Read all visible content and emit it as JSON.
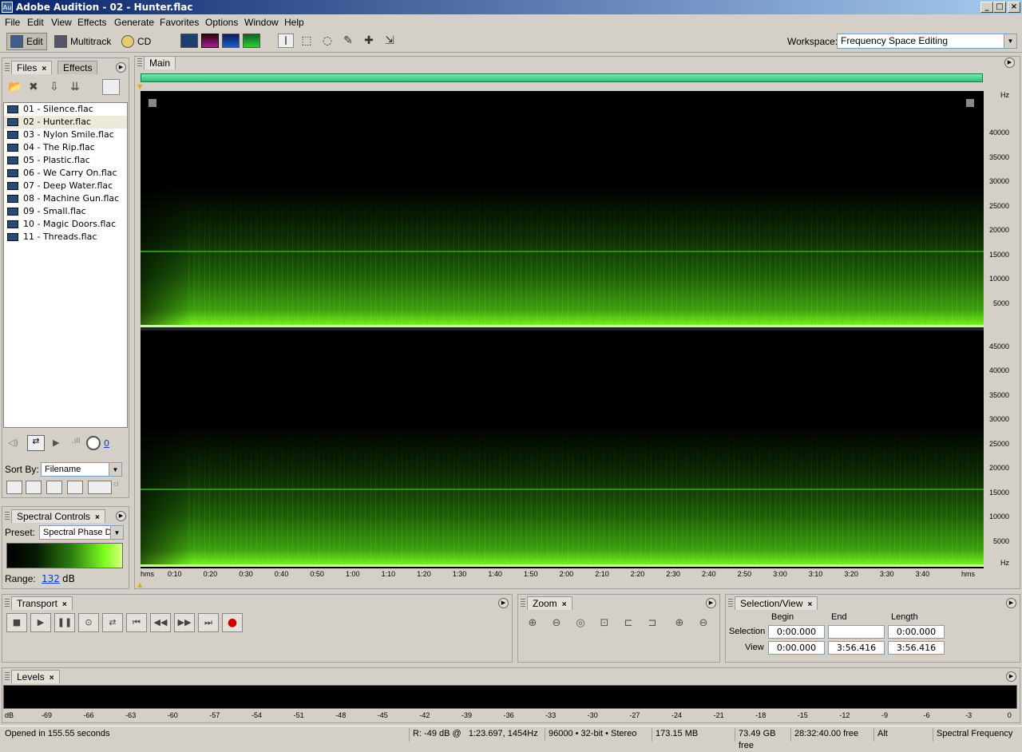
{
  "window": {
    "title": "Adobe Audition - 02 - Hunter.flac",
    "icon_text": "Au"
  },
  "menu": [
    "File",
    "Edit",
    "View",
    "Effects",
    "Generate",
    "Favorites",
    "Options",
    "Window",
    "Help"
  ],
  "toolbar": {
    "edit": "Edit",
    "multitrack": "Multitrack",
    "cd": "CD",
    "workspace_label": "Workspace:",
    "workspace_value": "Frequency Space Editing"
  },
  "files_panel": {
    "tab_files": "Files",
    "tab_effects": "Effects",
    "files": [
      "01 - Silence.flac",
      "02 - Hunter.flac",
      "03 - Nylon Smile.flac",
      "04 - The Rip.flac",
      "05 - Plastic.flac",
      "06 - We Carry On.flac",
      "07 - Deep Water.flac",
      "08 - Machine Gun.flac",
      "09 - Small.flac",
      "10 - Magic Doors.flac",
      "11 - Threads.flac"
    ],
    "selected_index": 1,
    "volume_value": "0",
    "sort_label": "Sort By:",
    "sort_value": "Filename"
  },
  "spectral": {
    "tab": "Spectral Controls",
    "preset_label": "Preset:",
    "preset_value": "Spectral Phase D",
    "range_label": "Range:",
    "range_value": "132",
    "range_unit": "dB"
  },
  "editor": {
    "tab": "Main",
    "hz_top": [
      "Hz",
      "40000",
      "35000",
      "30000",
      "25000",
      "20000",
      "15000",
      "10000",
      "5000"
    ],
    "hz_bottom": [
      "45000",
      "40000",
      "35000",
      "30000",
      "25000",
      "20000",
      "15000",
      "10000",
      "5000",
      "Hz"
    ],
    "time_labels": [
      "hms",
      "0:10",
      "0:20",
      "0:30",
      "0:40",
      "0:50",
      "1:00",
      "1:10",
      "1:20",
      "1:30",
      "1:40",
      "1:50",
      "2:00",
      "2:10",
      "2:20",
      "2:30",
      "2:40",
      "2:50",
      "3:00",
      "3:10",
      "3:20",
      "3:30",
      "3:40",
      "hms"
    ]
  },
  "transport": {
    "tab": "Transport"
  },
  "zoom": {
    "tab": "Zoom"
  },
  "selection_view": {
    "tab": "Selection/View",
    "headers": [
      "Begin",
      "End",
      "Length"
    ],
    "selection_label": "Selection",
    "selection": [
      "0:00.000",
      "",
      "0:00.000"
    ],
    "view_label": "View",
    "view": [
      "0:00.000",
      "3:56.416",
      "3:56.416"
    ]
  },
  "levels": {
    "tab": "Levels",
    "labels": [
      "dB",
      "-69",
      "-66",
      "-63",
      "-60",
      "-57",
      "-54",
      "-51",
      "-48",
      "-45",
      "-42",
      "-39",
      "-36",
      "-33",
      "-30",
      "-27",
      "-24",
      "-21",
      "-18",
      "-15",
      "-12",
      "-9",
      "-6",
      "-3",
      "0"
    ]
  },
  "status": {
    "opened": "Opened in 155.55 seconds",
    "cursor": "R: -49 dB @   1:23.697, 1454Hz",
    "format": "96000 • 32-bit • Stereo",
    "size": "173.15 MB",
    "free": "73.49 GB free",
    "time_free": "28:32:40.00 free",
    "key": "Alt",
    "view_mode": "Spectral Frequency"
  },
  "colors": {
    "spectrum_green": "#7dff1f",
    "overview_green": "#2fc080",
    "record_red": "#cc0000"
  }
}
